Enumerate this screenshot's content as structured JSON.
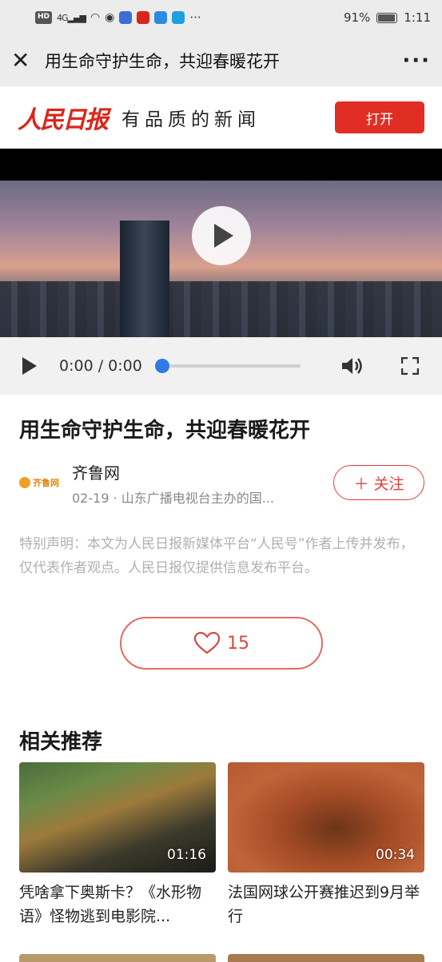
{
  "status_bar": {
    "left_badge": "HD",
    "network": "4G",
    "battery": "91%",
    "time": "1:11"
  },
  "title_bar": {
    "title": "用生命守护生命，共迎春暖花开"
  },
  "brand": {
    "logo": "人民日报",
    "slogan": "有品质的新闻",
    "open_label": "打开"
  },
  "player": {
    "time_label": "0:00 / 0:00"
  },
  "article": {
    "title": "用生命守护生命，共迎春暖花开",
    "author": "齐鲁网",
    "logo_text": "齐鲁网",
    "meta": "02-19 · 山东广播电视台主办的国...",
    "follow_label": "＋ 关注",
    "disclaimer": "特别声明：本文为人民日报新媒体平台“人民号”作者上传并发布，仅代表作者观点。人民日报仅提供信息发布平台。",
    "likes": "15"
  },
  "recommend": {
    "heading": "相关推荐",
    "items": [
      {
        "duration": "01:16",
        "caption": "凭啥拿下奥斯卡？《水形物语》怪物逃到电影院..."
      },
      {
        "duration": "00:34",
        "caption": "法国网球公开赛推迟到9月举行"
      }
    ]
  },
  "colors": {
    "brand_red": "#e02e24",
    "follow_red": "#e0403a",
    "seek_blue": "#2f7ae5"
  }
}
